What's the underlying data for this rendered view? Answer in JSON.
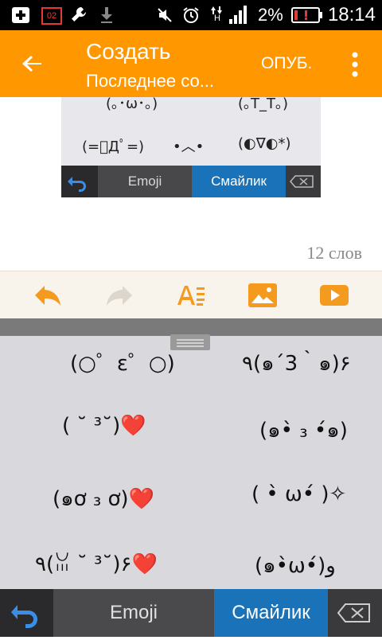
{
  "status_bar": {
    "sim_badge": "02",
    "battery_percent": "2%",
    "time": "18:14",
    "network_type": "H",
    "icons": [
      "add-icon",
      "sim-icon",
      "wrench-icon",
      "download-icon",
      "mute-icon",
      "alarm-icon",
      "signal-icon",
      "battery-alert-icon"
    ]
  },
  "app_bar": {
    "title": "Создать",
    "subtitle": "Последнее со...",
    "publish_label": "ОПУБ.",
    "color": "#ff9800"
  },
  "embedded_screenshot": {
    "rows": [
      [
        "(｡･ω･｡)",
        "(｡T_T｡)"
      ],
      [
        "(=ﾟДﾟ=)",
        "•︿•",
        "(◐∇◐*)"
      ]
    ],
    "tabs": {
      "emoji": "Emoji",
      "smiley": "Смайлик"
    }
  },
  "editor": {
    "word_count": "12 слов"
  },
  "toolbar": {
    "items": [
      "undo-icon",
      "redo-icon",
      "text-format-icon",
      "image-icon",
      "video-icon"
    ],
    "accent": "#f39a1f"
  },
  "keyboard": {
    "kaomoji": [
      {
        "left": "(○゜ε゜○)",
        "right": "٩(๑´3｀๑)۶"
      },
      {
        "left": "( ˘ ³˘)❤️",
        "right": "(๑•̀ ₃ •́๑)"
      },
      {
        "left": "(๑ơ ₃ ơ)❤️",
        "right": "( •̀ ω•́ )✧"
      },
      {
        "left": "٩(ꈍ ˘ ³˘)۶❤️",
        "right": "(๑•̀ω•́)و"
      }
    ],
    "tabs": {
      "emoji": "Emoji",
      "smiley": "Смайлик"
    },
    "active_tab_color": "#1a73b8"
  }
}
